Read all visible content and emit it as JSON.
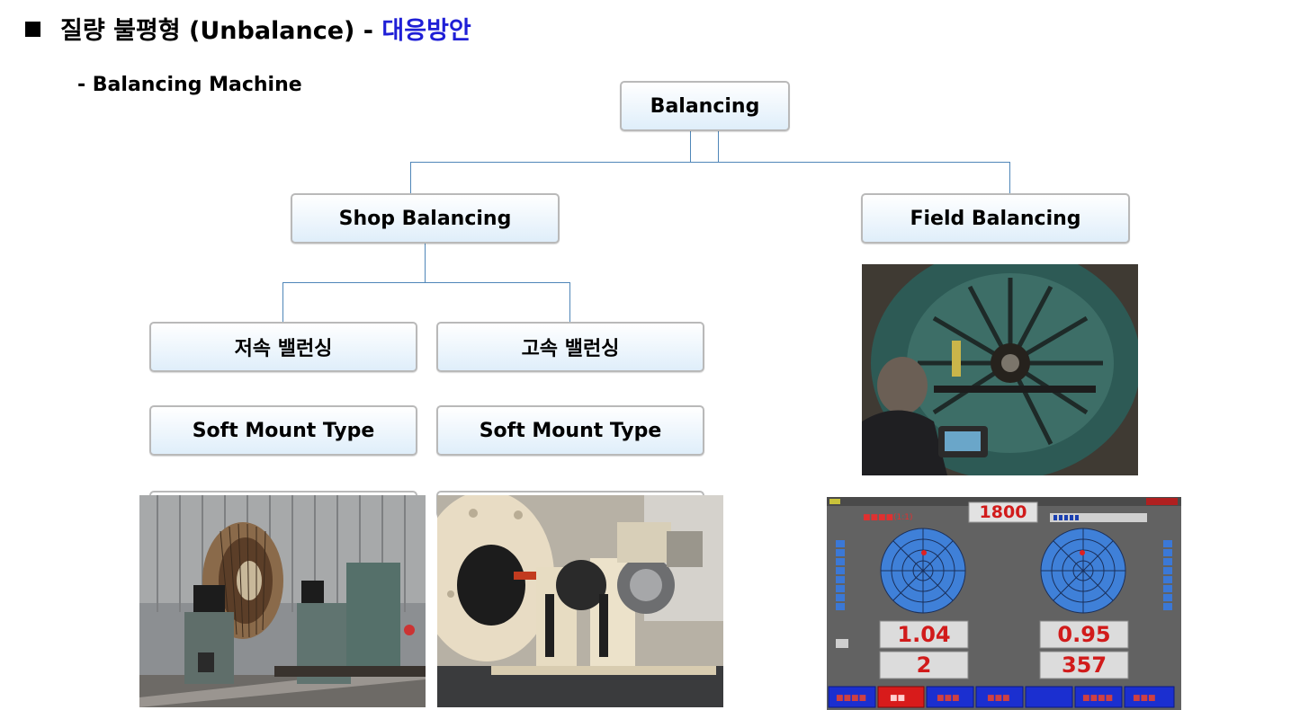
{
  "header": {
    "title_main": "질량 불평형 (Unbalance) - ",
    "title_accent": "대응방안",
    "subtitle": "- Balancing Machine"
  },
  "tree": {
    "root": "Balancing",
    "shop": "Shop Balancing",
    "field": "Field Balancing",
    "low_speed": "저속 밸런싱",
    "high_speed": "고속 밸런싱",
    "low_mount": "Soft Mount Type",
    "high_mount": "Soft Mount Type"
  },
  "screen": {
    "rpm": "1800",
    "value_left_1": "1.04",
    "value_left_2": "2",
    "value_right_1": "0.95",
    "value_right_2": "357"
  },
  "colors": {
    "accent": "#1f1fd6",
    "connector": "#4f86b8",
    "box_border": "#b9b9b9"
  }
}
